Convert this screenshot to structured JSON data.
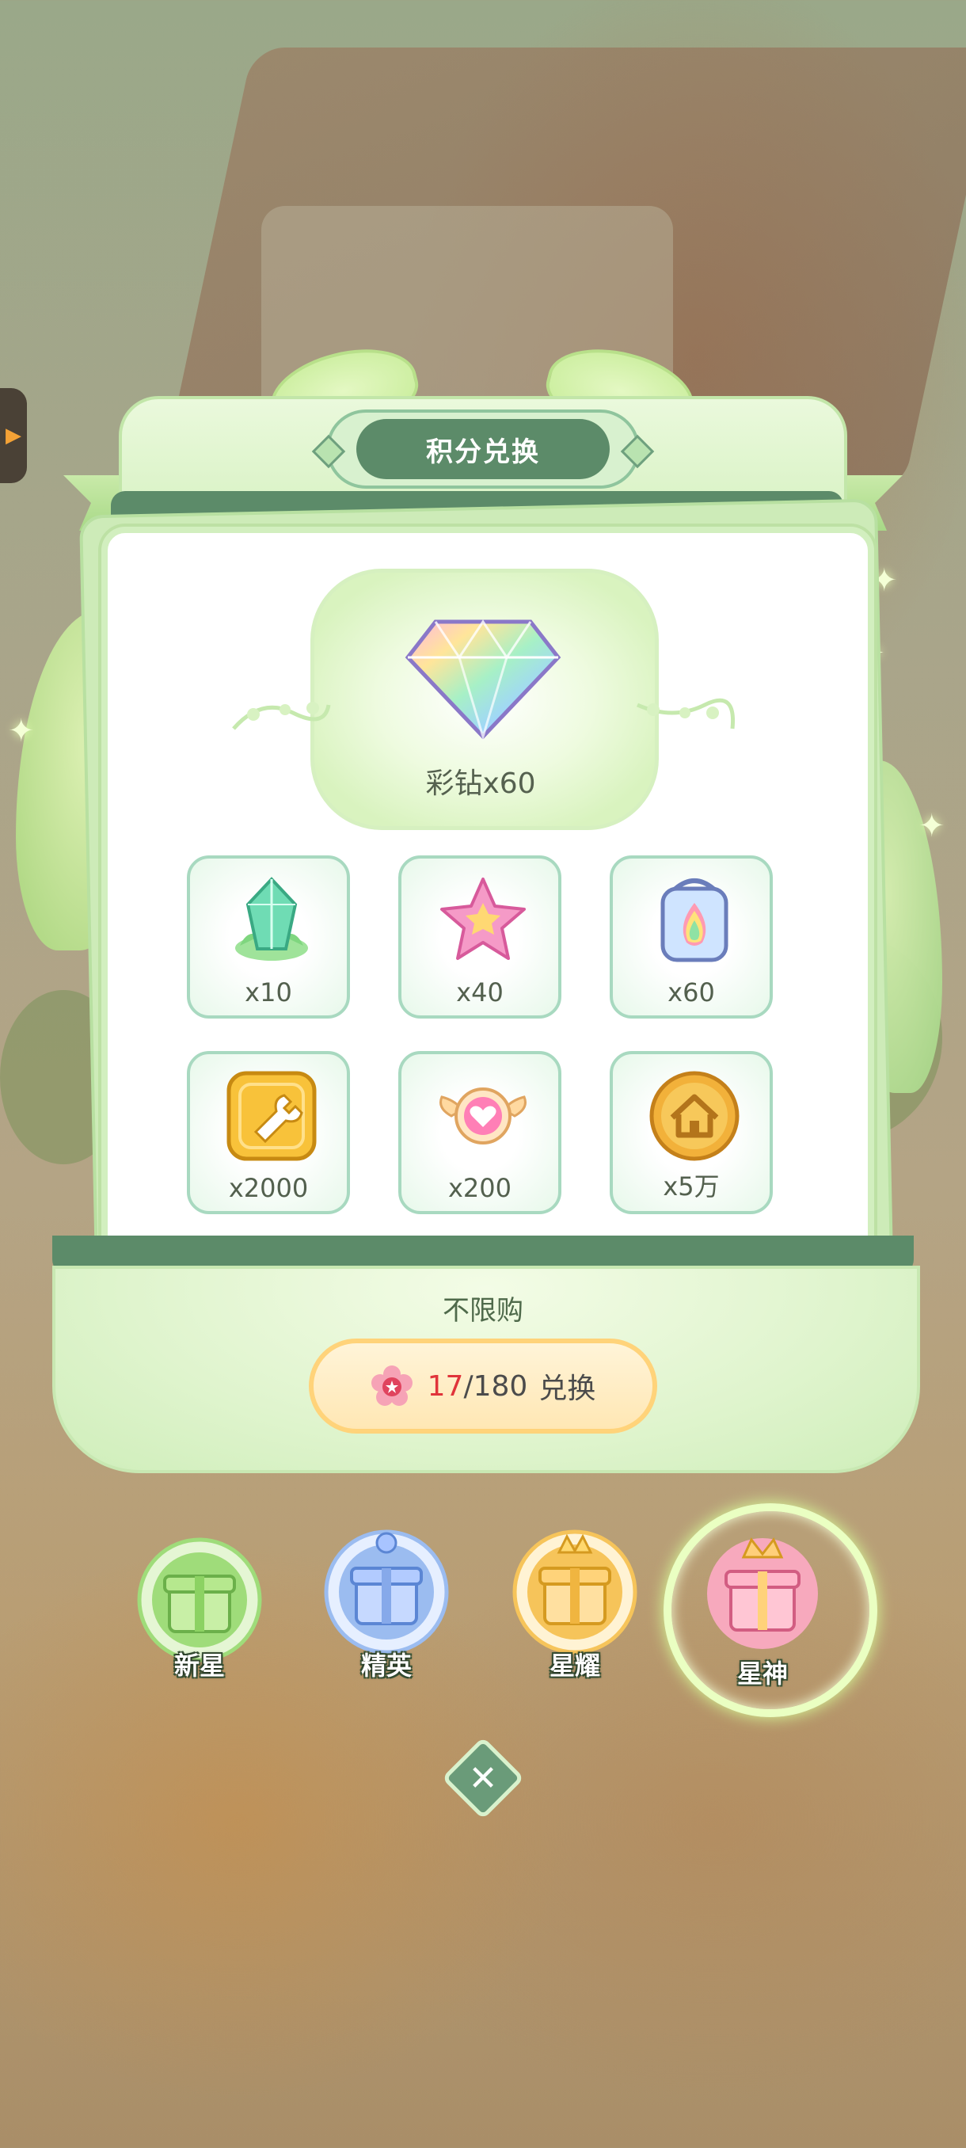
{
  "header": {
    "title": "积分兑换"
  },
  "featured": {
    "label": "彩钻x60",
    "icon": "rainbow-diamond-icon"
  },
  "rewards": [
    {
      "icon": "green-crystal-icon",
      "qty": "x10"
    },
    {
      "icon": "pink-star-icon",
      "qty": "x40"
    },
    {
      "icon": "rainbow-dye-jar-icon",
      "qty": "x60"
    },
    {
      "icon": "wrench-coin-icon",
      "qty": "x2000"
    },
    {
      "icon": "winged-heart-icon",
      "qty": "x200"
    },
    {
      "icon": "house-coin-icon",
      "qty": "x5万"
    }
  ],
  "limit": {
    "label": "不限购"
  },
  "redeem": {
    "current": "17",
    "total": "/180",
    "action": "兑换"
  },
  "tiers": [
    {
      "name": "新星",
      "color": "#9fdc7a"
    },
    {
      "name": "精英",
      "color": "#9bbcf0"
    },
    {
      "name": "星耀",
      "color": "#f6c45a"
    },
    {
      "name": "星神",
      "color": "#f49ab0",
      "active": true
    }
  ],
  "colors": {
    "accent_dark": "#5c8b69",
    "count_red": "#e0343a"
  }
}
